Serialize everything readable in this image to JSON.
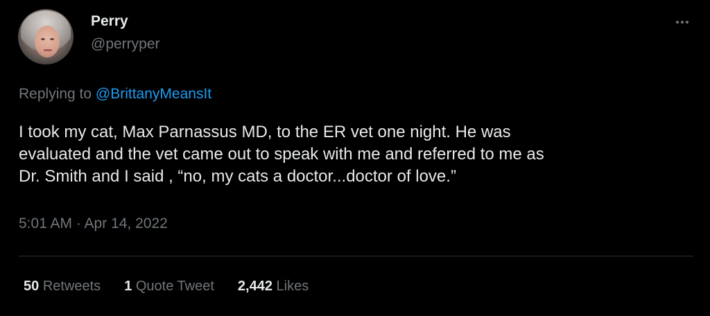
{
  "author": {
    "display_name": "Perry",
    "handle": "@perryper"
  },
  "reply": {
    "prefix": "Replying to ",
    "mention": "@BrittanyMeansIt"
  },
  "tweet": {
    "lines": [
      "I took my cat, Max Parnassus MD, to the ER vet one night. He was",
      "evaluated and the vet came out to speak with me and referred to me as",
      "Dr. Smith and I said , “no, my cats a doctor...doctor of love.”"
    ],
    "timestamp": "5:01 AM · Apr 14, 2022"
  },
  "stats": {
    "retweets_count": "50",
    "retweets_label": "Retweets",
    "quotes_count": "1",
    "quotes_label": "Quote Tweet",
    "likes_count": "2,442",
    "likes_label": "Likes"
  },
  "icons": {
    "more": "more-horizontal-icon"
  },
  "colors": {
    "background": "#000000",
    "text": "#e7e9ea",
    "secondary": "#71767b",
    "link": "#1d9bf0",
    "divider": "#2f3336"
  }
}
